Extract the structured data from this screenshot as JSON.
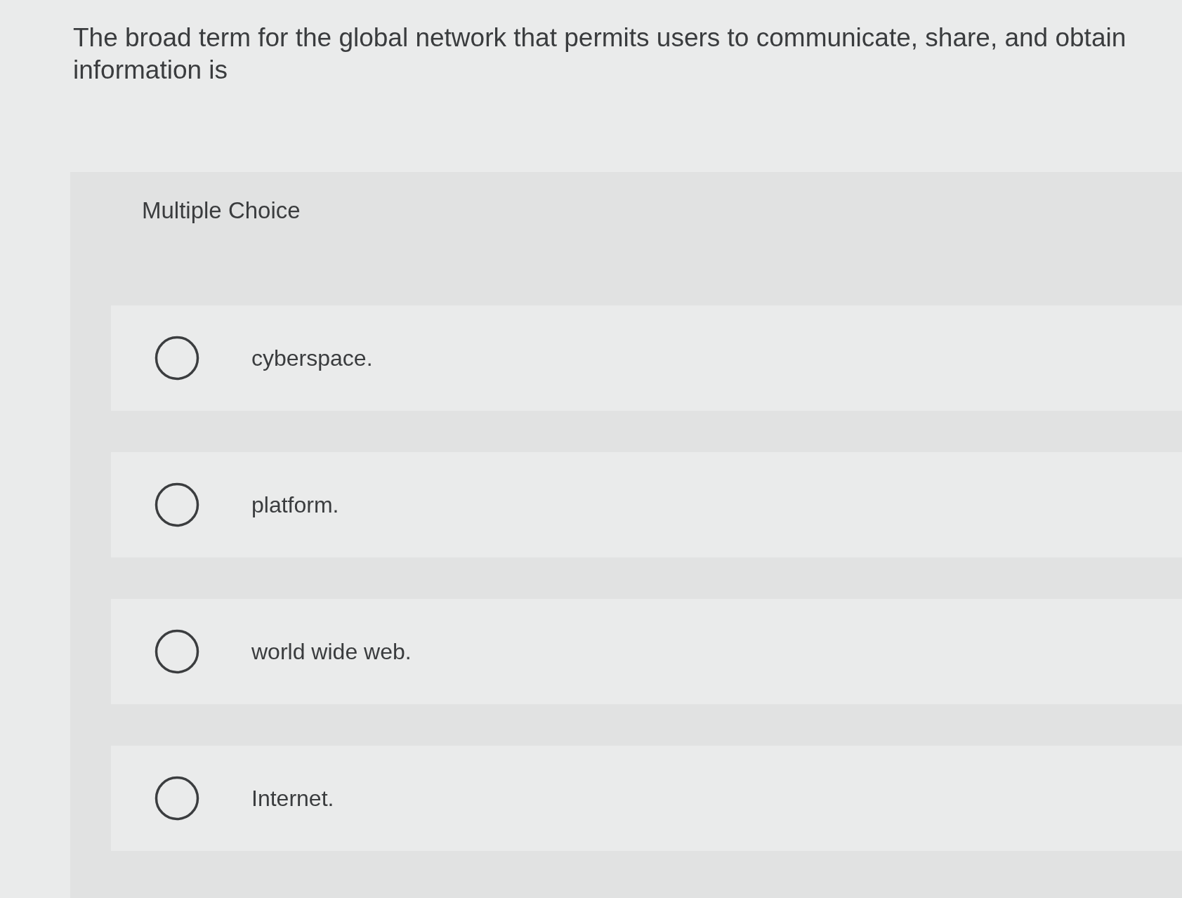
{
  "question": "The broad term for the global network that permits users to communicate, share, and obtain information is",
  "multiple_choice": {
    "heading": "Multiple Choice",
    "options": [
      {
        "label": "cyberspace.",
        "selected": false
      },
      {
        "label": "platform.",
        "selected": false
      },
      {
        "label": "world wide web.",
        "selected": false
      },
      {
        "label": "Internet.",
        "selected": false
      }
    ]
  }
}
